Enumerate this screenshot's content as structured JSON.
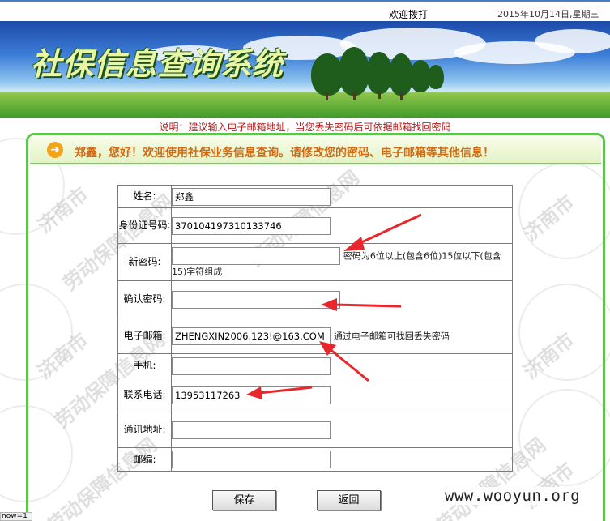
{
  "topbar": {
    "welcome": "欢迎拨打",
    "date": "2015年10月14日,星期三"
  },
  "banner": {
    "title": "社保信息查询系统"
  },
  "notice": "说明：建议输入电子邮箱地址，当您丢失密码后可依据邮箱找回密码",
  "panel": {
    "greeting": "郑鑫，您好！欢迎使用社保业务信息查询。请修改您的密码、电子邮箱等其他信息！"
  },
  "watermark": {
    "text_1": "济南市",
    "text_2": "劳动保障信息网"
  },
  "form": {
    "name_label": "姓名:",
    "name_value": "郑鑫",
    "idcard_label": "身份证号码:",
    "idcard_value": "370104197310133746",
    "newpwd_label": "新密码:",
    "newpwd_value": "",
    "newpwd_hint": "密码为6位以上(包含6位)15位以下(包含15)字符组成",
    "confirm_label": "确认密码:",
    "confirm_value": "",
    "email_label": "电子邮箱:",
    "email_value": "ZHENGXIN2006.123!@163.COM",
    "email_hint": "通过电子邮箱可找回丢失密码",
    "mobile_label": "手机:",
    "mobile_value": "",
    "phone_label": "联系电话:",
    "phone_value": "13953117263",
    "address_label": "通讯地址:",
    "address_value": "",
    "zip_label": "邮编:",
    "zip_value": ""
  },
  "buttons": {
    "save": "保存",
    "back": "返回"
  },
  "status_bar": "now=1",
  "brand": "www.wooyun.org",
  "colors": {
    "accent_green": "#5ec54b",
    "greeting_orange": "#d26a12",
    "notice_red": "#b51e1e",
    "annotation_arrow": "#e8262b"
  }
}
